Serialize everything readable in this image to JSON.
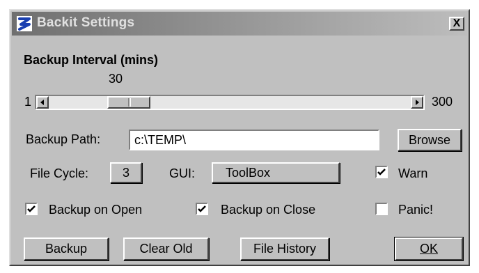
{
  "window": {
    "title": "Backit Settings",
    "close_label": "X"
  },
  "backup_interval": {
    "heading": "Backup Interval (mins)",
    "min_label": "1",
    "max_label": "300",
    "value_label": "30",
    "min": 1,
    "max": 300,
    "value": 30
  },
  "backup_path": {
    "label": "Backup Path:",
    "value": "c:\\TEMP\\",
    "browse_label": "Browse"
  },
  "file_cycle": {
    "label": "File Cycle:",
    "value": "3"
  },
  "gui": {
    "label": "GUI:",
    "value": "ToolBox"
  },
  "checkboxes": {
    "warn": {
      "label": "Warn",
      "checked": true
    },
    "backup_on_open": {
      "label": "Backup on Open",
      "checked": true
    },
    "backup_on_close": {
      "label": "Backup on Close",
      "checked": true
    },
    "panic": {
      "label": "Panic!",
      "checked": false
    }
  },
  "buttons": {
    "backup": "Backup",
    "clear_old": "Clear Old",
    "file_history": "File History",
    "ok": "OK"
  },
  "icons": {
    "app": "backit-app-icon",
    "close": "close-icon",
    "left_arrow": "arrow-left-icon",
    "right_arrow": "arrow-right-icon",
    "check": "checkmark-icon"
  }
}
